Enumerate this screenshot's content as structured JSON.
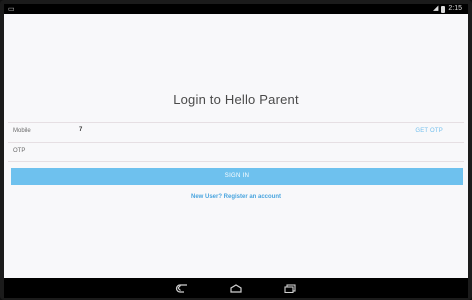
{
  "status_bar": {
    "time": "2:15",
    "left_icon": "notification-icon",
    "icons": [
      "signal-icon",
      "battery-icon"
    ]
  },
  "login": {
    "title": "Login to Hello Parent",
    "mobile_label": "Mobile",
    "mobile_value": "7",
    "get_otp_label": "GET OTP",
    "otp_label": "OTP",
    "sign_in_label": "SIGN IN",
    "register_link": "New User? Register an account"
  },
  "nav_bar": {
    "buttons": [
      "back-icon",
      "home-icon",
      "recent-apps-icon"
    ]
  },
  "colors": {
    "accent": "#6ec1ee",
    "link": "#4aa5df",
    "background": "#f8f8fa"
  }
}
